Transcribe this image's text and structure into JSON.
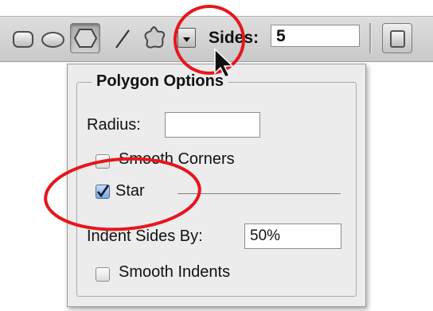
{
  "toolbar": {
    "tools": [
      {
        "name": "rectangle-tool-icon"
      },
      {
        "name": "ellipse-tool-icon"
      },
      {
        "name": "polygon-tool-icon",
        "active": true
      },
      {
        "name": "line-tool-icon"
      },
      {
        "name": "custom-shape-tool-icon"
      },
      {
        "name": "geometry-options-dropdown-icon"
      }
    ],
    "sides_label": "Sides:",
    "sides_value": "5"
  },
  "panel": {
    "title": "Polygon Options",
    "radius_label": "Radius:",
    "radius_value": "",
    "smooth_corners_label": "Smooth Corners",
    "smooth_corners_checked": false,
    "star_label": "Star",
    "star_checked": true,
    "indent_label": "Indent Sides By:",
    "indent_value": "50%",
    "smooth_indents_label": "Smooth Indents",
    "smooth_indents_checked": false
  },
  "colors": {
    "annotation_red": "#e5161d",
    "checkbox_blue": "#4a7fc1"
  }
}
